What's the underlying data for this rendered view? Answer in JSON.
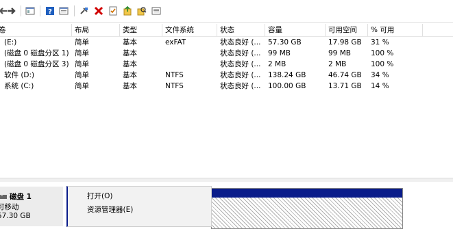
{
  "toolbar": {
    "icons": [
      "back-arrow-icon",
      "forward-arrow-icon",
      "console-tree-icon",
      "help-icon",
      "properties-icon",
      "connect-disk-icon",
      "delete-icon",
      "check-icon",
      "volume-up-icon",
      "volume-search-icon",
      "view-icon"
    ]
  },
  "volume_list": {
    "columns": [
      "卷",
      "布局",
      "类型",
      "文件系统",
      "状态",
      "容量",
      "可用空间",
      "% 可用"
    ],
    "rows": [
      {
        "volume": "(E:)",
        "layout": "简单",
        "type": "基本",
        "fs": "exFAT",
        "status": "状态良好 (...",
        "capacity": "57.30 GB",
        "free": "17.98 GB",
        "pct": "31 %"
      },
      {
        "volume": "(磁盘 0 磁盘分区 1)",
        "layout": "简单",
        "type": "基本",
        "fs": "",
        "status": "状态良好 (...",
        "capacity": "99 MB",
        "free": "99 MB",
        "pct": "100 %"
      },
      {
        "volume": "(磁盘 0 磁盘分区 3)",
        "layout": "简单",
        "type": "基本",
        "fs": "",
        "status": "状态良好 (...",
        "capacity": "2 MB",
        "free": "2 MB",
        "pct": "100 %"
      },
      {
        "volume": "软件 (D:)",
        "layout": "简单",
        "type": "基本",
        "fs": "NTFS",
        "status": "状态良好 (...",
        "capacity": "138.24 GB",
        "free": "46.74 GB",
        "pct": "34 %"
      },
      {
        "volume": "系统 (C:)",
        "layout": "简单",
        "type": "基本",
        "fs": "NTFS",
        "status": "状态良好 (...",
        "capacity": "100.00 GB",
        "free": "13.71 GB",
        "pct": "14 %"
      }
    ]
  },
  "disk_panel": {
    "name": "磁盘 1",
    "kind": "可移动",
    "size": "57.30 GB"
  },
  "context_menu": {
    "items": [
      "打开(O)",
      "资源管理器(E)"
    ]
  },
  "colors": {
    "partition_bar": "#0a1c8a",
    "delete_red": "#d00000",
    "help_blue": "#1f5fbf"
  }
}
